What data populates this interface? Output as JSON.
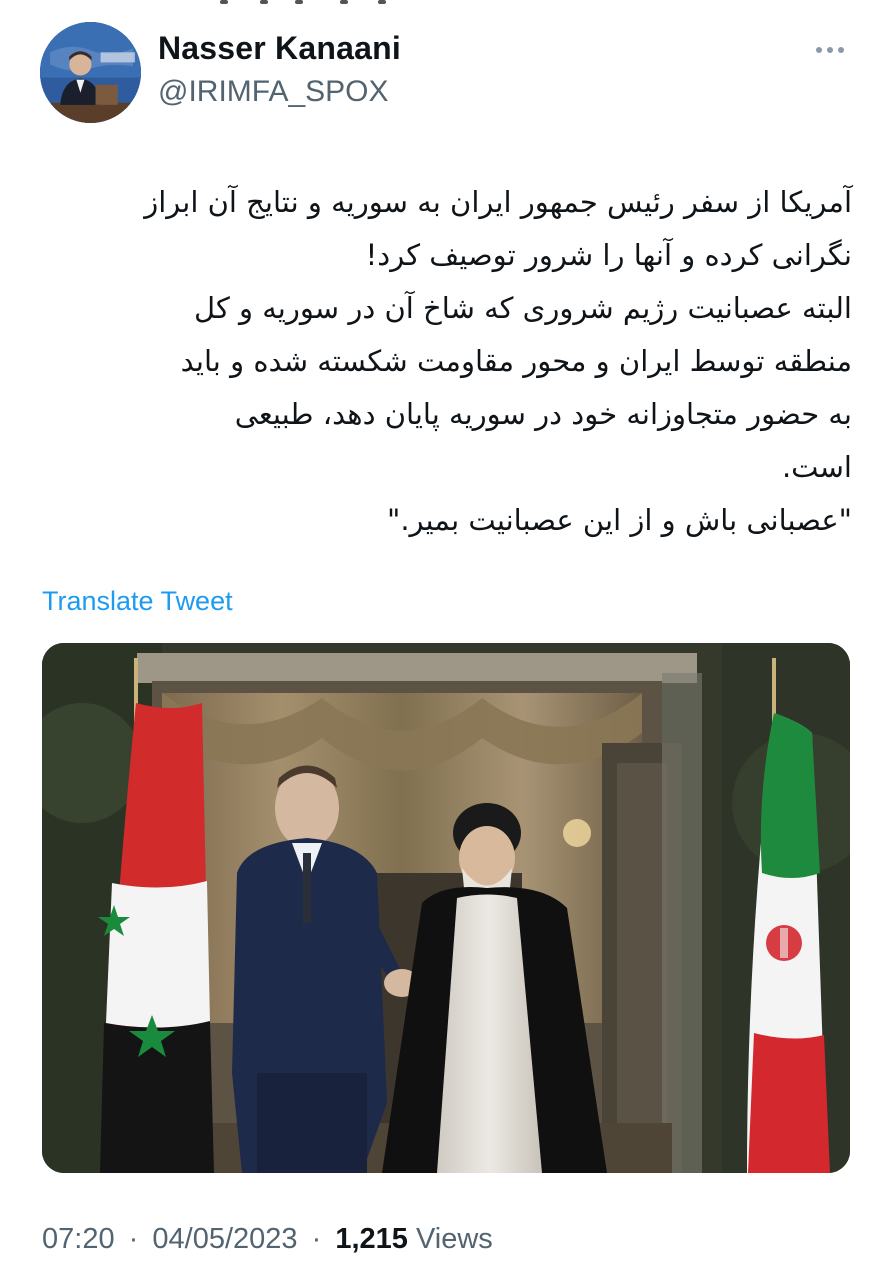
{
  "author": {
    "name": "Nasser Kanaani",
    "handle": "@IRIMFA_SPOX",
    "avatar_icon": "profile-photo"
  },
  "more_icon": "more-dots-icon",
  "tweet": {
    "lines": [
      "آمریکا از سفر رئیس جمهور ایران به سوریه و نتایج آن ابراز",
      "نگرانی کرده و آنها را شرور توصیف کرد!",
      "البته عصبانیت رژیم شروری که شاخ آن در سوریه و کل",
      "منطقه توسط ایران و محور مقاومت شکسته شده و باید",
      "به حضور متجاوزانه خود در سوریه پایان دهد، طبیعی",
      "است.",
      "\"عصبانی باش و از این عصبانیت بمیر.\""
    ],
    "translate_label": "Translate Tweet"
  },
  "meta": {
    "time": "07:20",
    "date": "04/05/2023",
    "separator": "·",
    "views_count": "1,215",
    "views_label": "Views"
  },
  "colors": {
    "link": "#1d9bf0",
    "secondary_text": "#536471",
    "primary_text": "#0f1419"
  }
}
